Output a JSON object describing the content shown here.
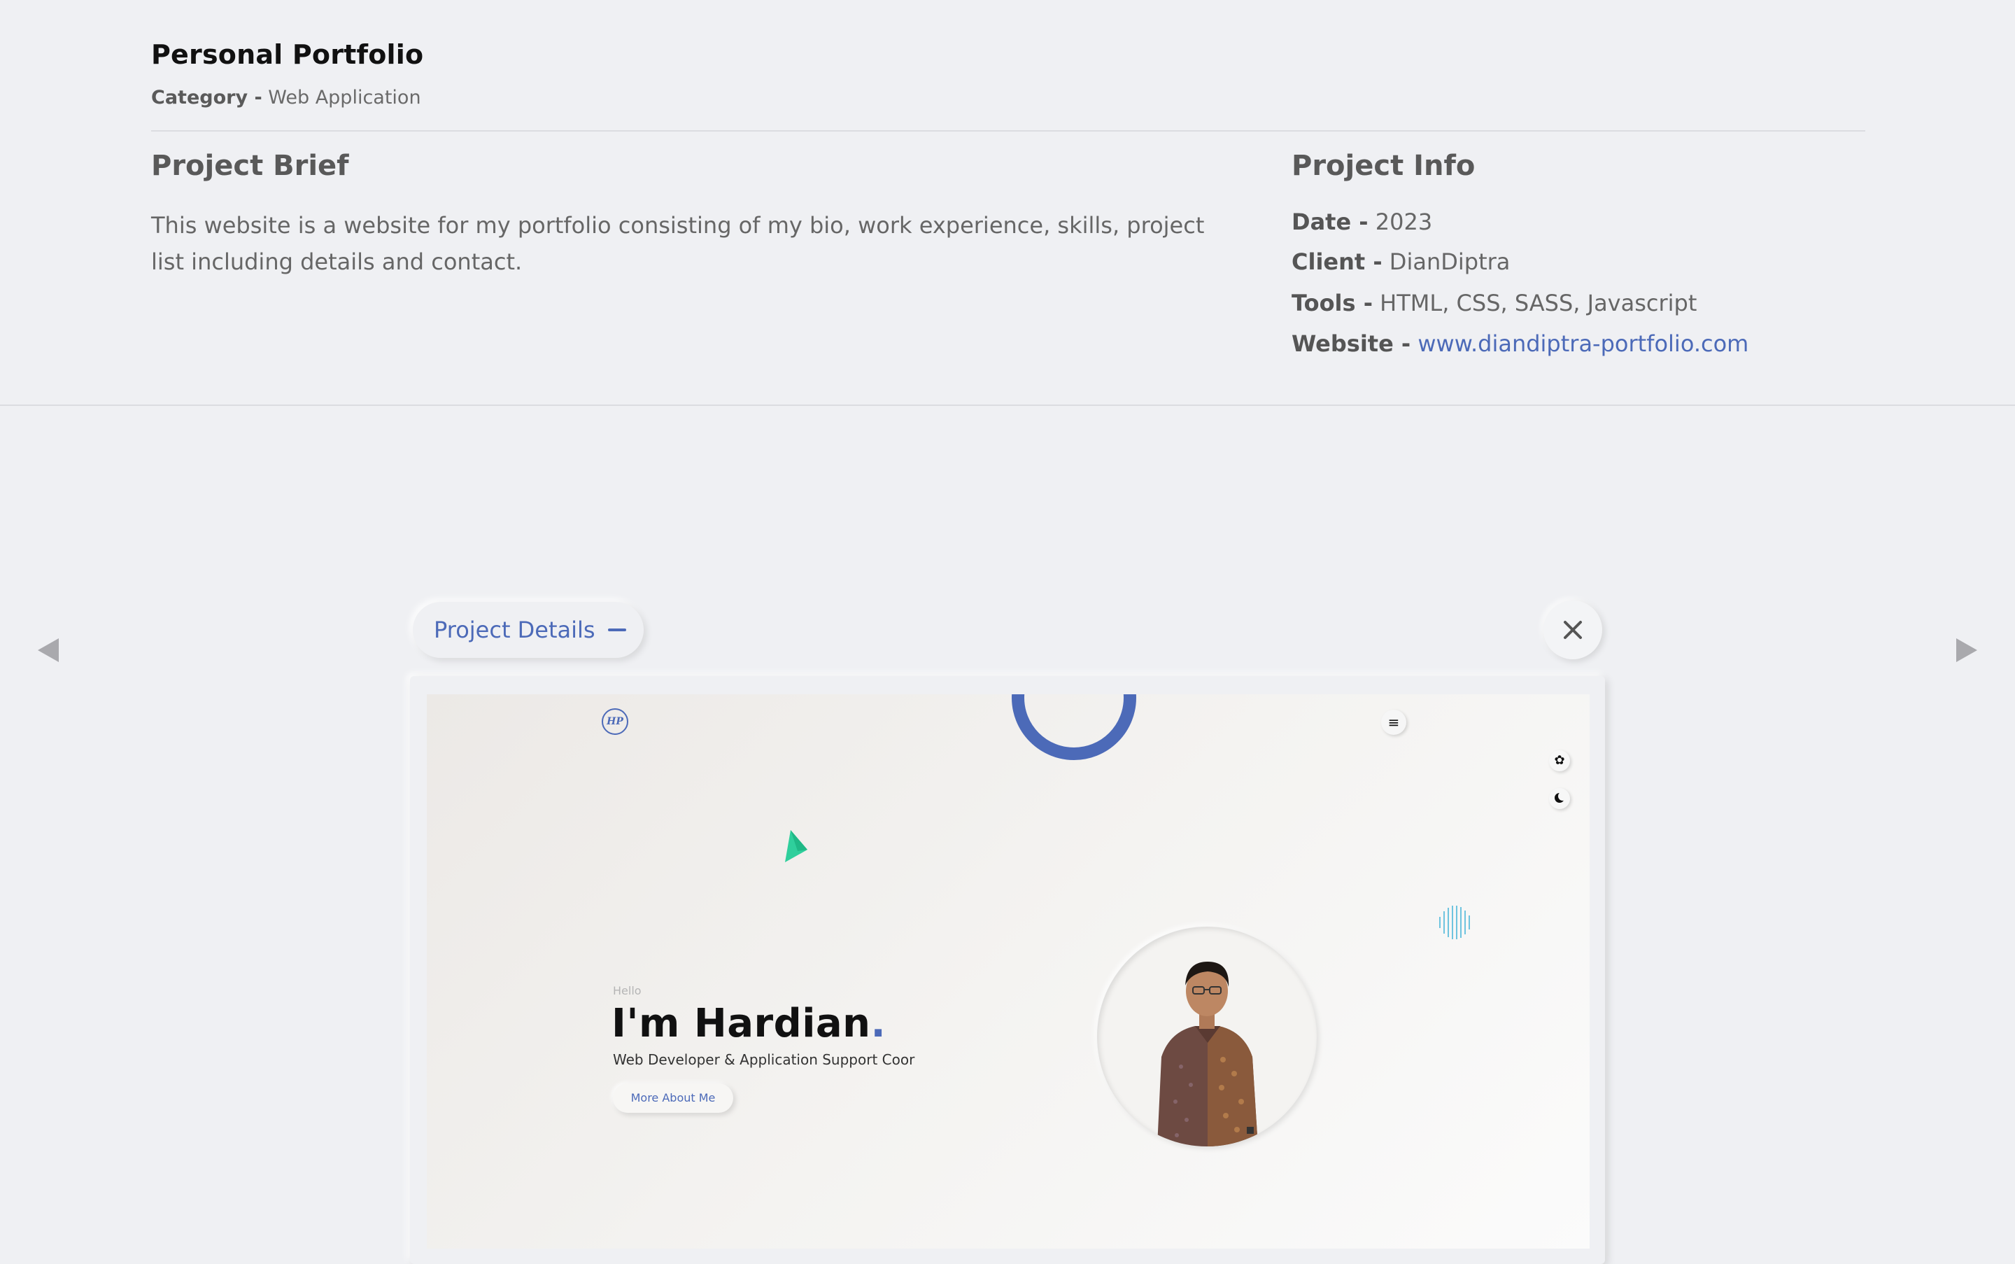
{
  "project": {
    "title": "Personal Portfolio",
    "category_label": "Category -",
    "category_value": "Web Application"
  },
  "brief": {
    "heading": "Project Brief",
    "text": "This website is a website for my portfolio consisting of my bio, work experience, skills, project list including details and contact."
  },
  "info": {
    "heading": "Project Info",
    "date_label": "Date -",
    "date_value": "2023",
    "client_label": "Client -",
    "client_value": "DianDiptra",
    "tools_label": "Tools -",
    "tools_value": "HTML, CSS, SASS, Javascript",
    "website_label": "Website -",
    "website_value": "www.diandiptra-portfolio.com"
  },
  "controls": {
    "details_label": "Project Details",
    "close_icon": "close-icon",
    "prev_icon": "triangle-left-icon",
    "next_icon": "triangle-right-icon"
  },
  "preview": {
    "logo_text": "HP",
    "menu_icon": "≡",
    "settings_icon": "✿",
    "hello": "Hello",
    "name": "I'm Hardian",
    "name_dot": ".",
    "role": "Web Developer & Application Support Coor",
    "button": "More About Me"
  },
  "colors": {
    "accent": "#4c6ab8",
    "background": "#eff0f3",
    "triangle": "#2fcf9c"
  }
}
